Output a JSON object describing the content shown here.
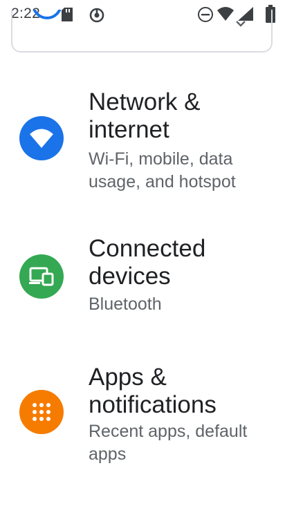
{
  "status_bar": {
    "time": "2:22",
    "icons": [
      "sd-card-icon",
      "do-not-disturb-icon",
      "minus-circle-icon",
      "wifi-icon",
      "signal-icon",
      "battery-icon"
    ]
  },
  "suggestion_card": {
    "icon": "sync-icon",
    "expand_icon": "chevron-down-icon"
  },
  "settings": [
    {
      "id": "network",
      "title": "Network & internet",
      "subtitle": "Wi-Fi, mobile, data usage, and hotspot",
      "icon": "wifi-icon",
      "color": "#1a73e8"
    },
    {
      "id": "connected",
      "title": "Connected devices",
      "subtitle": "Bluetooth",
      "icon": "connected-devices-icon",
      "color": "#34a853"
    },
    {
      "id": "apps",
      "title": "Apps & notifications",
      "subtitle": "Recent apps, default apps",
      "icon": "apps-grid-icon",
      "color": "#f57c00"
    }
  ]
}
